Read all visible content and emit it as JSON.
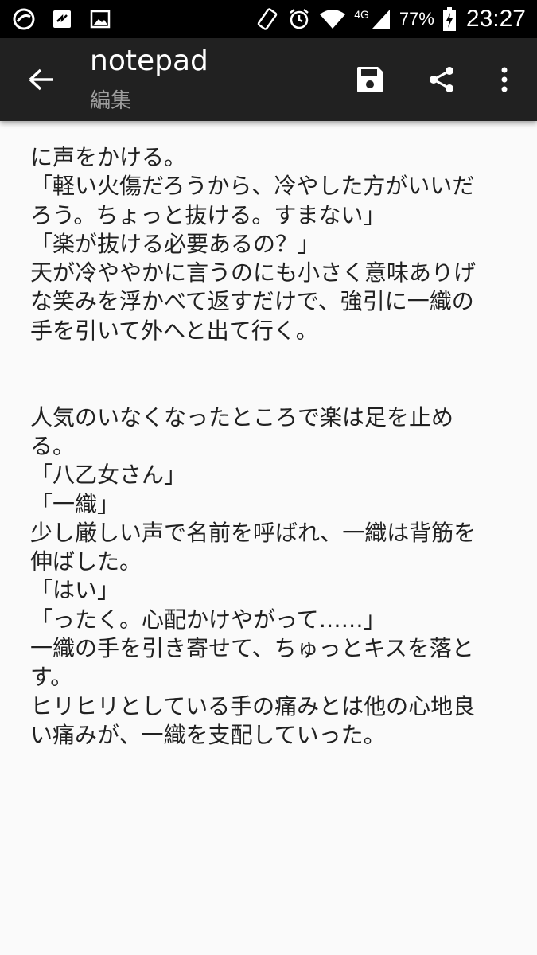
{
  "status_bar": {
    "icons_left": [
      "app-notification-icon",
      "transfer-icon",
      "image-icon"
    ],
    "network": "4G",
    "battery": "77%",
    "time": "23:27"
  },
  "app_bar": {
    "title": "notepad",
    "subtitle": "編集"
  },
  "document": {
    "lines": [
      "に声をかける。",
      "「軽い火傷だろうから、冷やした方がいいだ",
      "ろう。ちょっと抜ける。すまない」",
      "「楽が抜ける必要あるの？」",
      "天が冷ややかに言うのにも小さく意味ありげ",
      "な笑みを浮かべて返すだけで、強引に一織の",
      "手を引いて外へと出て行く。",
      "",
      "",
      "人気のいなくなったところで楽は足を止め",
      "る。",
      "「八乙女さん」",
      "「一織」",
      "少し厳しい声で名前を呼ばれ、一織は背筋を",
      "伸ばした。",
      "「はい」",
      "「ったく。心配かけやがって……」",
      "一織の手を引き寄せて、ちゅっとキスを落と",
      "す。",
      "ヒリヒリとしている手の痛みとは他の心地良",
      "い痛みが、一織を支配していった。"
    ]
  }
}
